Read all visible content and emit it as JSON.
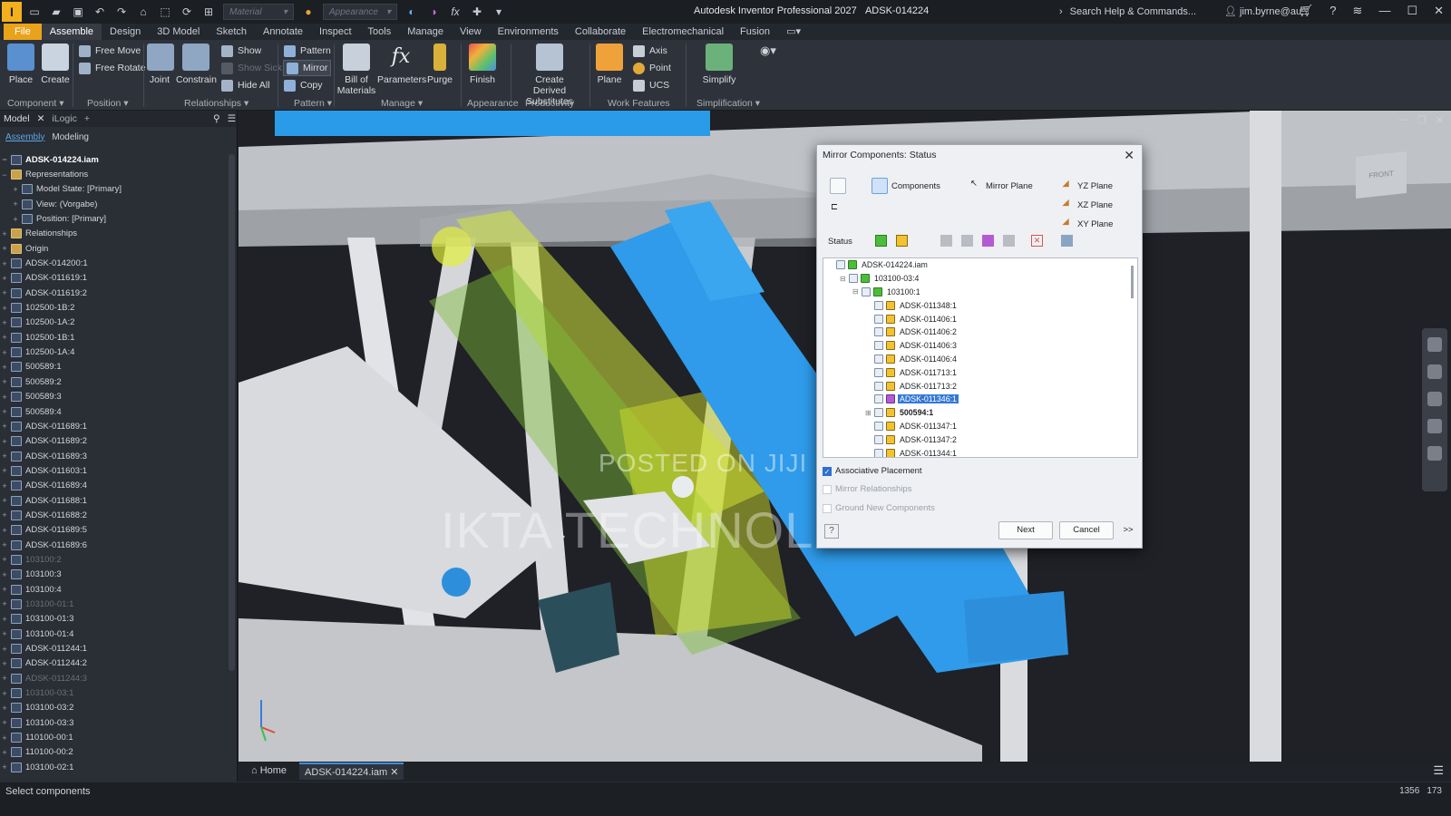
{
  "app": {
    "title": "Autodesk Inventor Professional 2027",
    "document": "ADSK-014224",
    "logo_letter": "I",
    "material_placeholder": "Material",
    "appearance_placeholder": "Appearance",
    "search_label": "Search Help & Commands...",
    "user": "jim.byrne@au..."
  },
  "tabs": [
    "File",
    "Assemble",
    "Design",
    "3D Model",
    "Sketch",
    "Annotate",
    "Inspect",
    "Tools",
    "Manage",
    "View",
    "Environments",
    "Collaborate",
    "Electromechanical",
    "Fusion"
  ],
  "ribbon": {
    "place": "Place",
    "create": "Create",
    "free_move": "Free Move",
    "free_rotate": "Free Rotate",
    "joint": "Joint",
    "constrain": "Constrain",
    "show": "Show",
    "show_sick": "Show Sick",
    "hide_all": "Hide All",
    "pattern": "Pattern",
    "mirror": "Mirror",
    "copy": "Copy",
    "bom_line1": "Bill of",
    "bom_line2": "Materials",
    "parameters": "Parameters",
    "purge": "Purge",
    "finish": "Finish",
    "derived_line1": "Create Derived",
    "derived_line2": "Substitutes",
    "plane": "Plane",
    "axis": "Axis",
    "point": "Point",
    "ucs": "UCS",
    "simplify": "Simplify",
    "groups": {
      "component": "Component",
      "position": "Position",
      "relationships": "Relationships",
      "pattern": "Pattern",
      "manage": "Manage",
      "appearance": "Appearance",
      "productivity": "Productivity",
      "work_features": "Work Features",
      "simplification": "Simplification"
    }
  },
  "browser": {
    "tab_model": "Model",
    "tab_ilogic": "iLogic",
    "sub_assembly": "Assembly",
    "sub_modeling": "Modeling",
    "root": "ADSK-014224.iam",
    "representations": "Representations",
    "model_state": "Model State: [Primary]",
    "view": "View: (Vorgabe)",
    "position": "Position: [Primary]",
    "relationships": "Relationships",
    "origin": "Origin",
    "items": [
      {
        "label": "ADSK-014200:1",
        "sup": false
      },
      {
        "label": "ADSK-011619:1",
        "sup": false
      },
      {
        "label": "ADSK-011619:2",
        "sup": false
      },
      {
        "label": "102500-1B:2",
        "sup": false
      },
      {
        "label": "102500-1A:2",
        "sup": false
      },
      {
        "label": "102500-1B:1",
        "sup": false
      },
      {
        "label": "102500-1A:4",
        "sup": false
      },
      {
        "label": "500589:1",
        "sup": false
      },
      {
        "label": "500589:2",
        "sup": false
      },
      {
        "label": "500589:3",
        "sup": false
      },
      {
        "label": "500589:4",
        "sup": false
      },
      {
        "label": "ADSK-011689:1",
        "sup": false
      },
      {
        "label": "ADSK-011689:2",
        "sup": false
      },
      {
        "label": "ADSK-011689:3",
        "sup": false
      },
      {
        "label": "ADSK-011603:1",
        "sup": false
      },
      {
        "label": "ADSK-011689:4",
        "sup": false
      },
      {
        "label": "ADSK-011688:1",
        "sup": false
      },
      {
        "label": "ADSK-011688:2",
        "sup": false
      },
      {
        "label": "ADSK-011689:5",
        "sup": false
      },
      {
        "label": "ADSK-011689:6",
        "sup": false
      },
      {
        "label": "103100:2",
        "sup": true
      },
      {
        "label": "103100:3",
        "sup": false
      },
      {
        "label": "103100:4",
        "sup": false
      },
      {
        "label": "103100-01:1",
        "sup": true
      },
      {
        "label": "103100-01:3",
        "sup": false
      },
      {
        "label": "103100-01:4",
        "sup": false
      },
      {
        "label": "ADSK-011244:1",
        "sup": false
      },
      {
        "label": "ADSK-011244:2",
        "sup": false
      },
      {
        "label": "ADSK-011244:3",
        "sup": true
      },
      {
        "label": "103100-03:1",
        "sup": true
      },
      {
        "label": "103100-03:2",
        "sup": false
      },
      {
        "label": "103100-03:3",
        "sup": false
      },
      {
        "label": "110100-00:1",
        "sup": false
      },
      {
        "label": "110100-00:2",
        "sup": false
      },
      {
        "label": "103100-02:1",
        "sup": false
      }
    ]
  },
  "dialog": {
    "title": "Mirror Components: Status",
    "components": "Components",
    "mirror_plane": "Mirror Plane",
    "yz_plane": "YZ Plane",
    "xz_plane": "XZ Plane",
    "xy_plane": "XY Plane",
    "status": "Status",
    "tree": [
      {
        "label": "ADSK-014224.iam",
        "indent": 0,
        "st": "g",
        "hl": false,
        "bold": false
      },
      {
        "label": "103100-03:4",
        "indent": 1,
        "st": "g",
        "hl": false,
        "bold": false
      },
      {
        "label": "103100:1",
        "indent": 2,
        "st": "g",
        "hl": false,
        "bold": false
      },
      {
        "label": "ADSK-011348:1",
        "indent": 3,
        "st": "y",
        "hl": false,
        "bold": false
      },
      {
        "label": "ADSK-011406:1",
        "indent": 3,
        "st": "y",
        "hl": false,
        "bold": false
      },
      {
        "label": "ADSK-011406:2",
        "indent": 3,
        "st": "y",
        "hl": false,
        "bold": false
      },
      {
        "label": "ADSK-011406:3",
        "indent": 3,
        "st": "y",
        "hl": false,
        "bold": false
      },
      {
        "label": "ADSK-011406:4",
        "indent": 3,
        "st": "y",
        "hl": false,
        "bold": false
      },
      {
        "label": "ADSK-011713:1",
        "indent": 3,
        "st": "y",
        "hl": false,
        "bold": false
      },
      {
        "label": "ADSK-011713:2",
        "indent": 3,
        "st": "y",
        "hl": false,
        "bold": false
      },
      {
        "label": "ADSK-011346:1",
        "indent": 3,
        "st": "p",
        "hl": true,
        "bold": false
      },
      {
        "label": "500594:1",
        "indent": 3,
        "st": "y",
        "hl": false,
        "bold": true
      },
      {
        "label": "ADSK-011347:1",
        "indent": 3,
        "st": "y",
        "hl": false,
        "bold": false
      },
      {
        "label": "ADSK-011347:2",
        "indent": 3,
        "st": "y",
        "hl": false,
        "bold": false
      },
      {
        "label": "ADSK-011344:1",
        "indent": 3,
        "st": "y",
        "hl": false,
        "bold": false
      }
    ],
    "associative_placement": "Associative Placement",
    "mirror_relationships": "Mirror Relationships",
    "ground_new": "Ground New Components",
    "next": "Next",
    "cancel": "Cancel",
    "more": ">>"
  },
  "viewport": {
    "viewcube_label": "FRONT",
    "watermark_top": "POSTED ON JIJI",
    "watermark_main": "IKTA TECHNOLOGIES"
  },
  "doc_tabs": {
    "home": "Home",
    "file": "ADSK-014224.iam"
  },
  "statusbar": {
    "text": "Select components",
    "num1": "1356",
    "num2": "173"
  },
  "colors": {
    "accent_blue": "#3aa0f0",
    "highlight_yellow": "#d7e42a",
    "file_tab": "#e8a31b"
  }
}
